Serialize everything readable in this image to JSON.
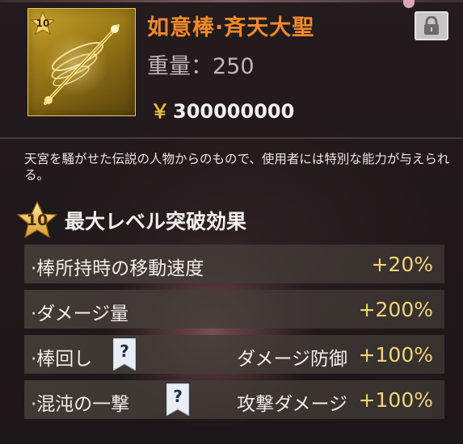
{
  "item": {
    "level_badge": "10",
    "name": "如意棒·斉天大聖",
    "weight_label": "重量：250",
    "price_symbol": "￥",
    "price_value": "300000000",
    "description": "天宮を騒がせた伝説の人物からのもので、使用者には特別な能力が与えられる。"
  },
  "section": {
    "level": "10",
    "title": "最大レベル突破効果"
  },
  "effects": [
    {
      "label": "·棒所持時の移動速度",
      "sub": "",
      "value": "+20%",
      "has_help": false
    },
    {
      "label": "·ダメージ量",
      "sub": "",
      "value": "+200%",
      "has_help": false
    },
    {
      "label": "·棒回し",
      "sub": "ダメージ防御",
      "value": "+100%",
      "has_help": true,
      "help_text": "?"
    },
    {
      "label": "·混沌の一撃",
      "sub": "攻撃ダメージ",
      "value": "+100%",
      "has_help": true,
      "help_text": "?"
    }
  ],
  "icons": {
    "lock": "lock-icon",
    "help": "help-icon",
    "star": "star-level-icon"
  },
  "colors": {
    "title": "#f08a2b",
    "value": "#f3d27a",
    "price_symbol": "#e7b838"
  }
}
